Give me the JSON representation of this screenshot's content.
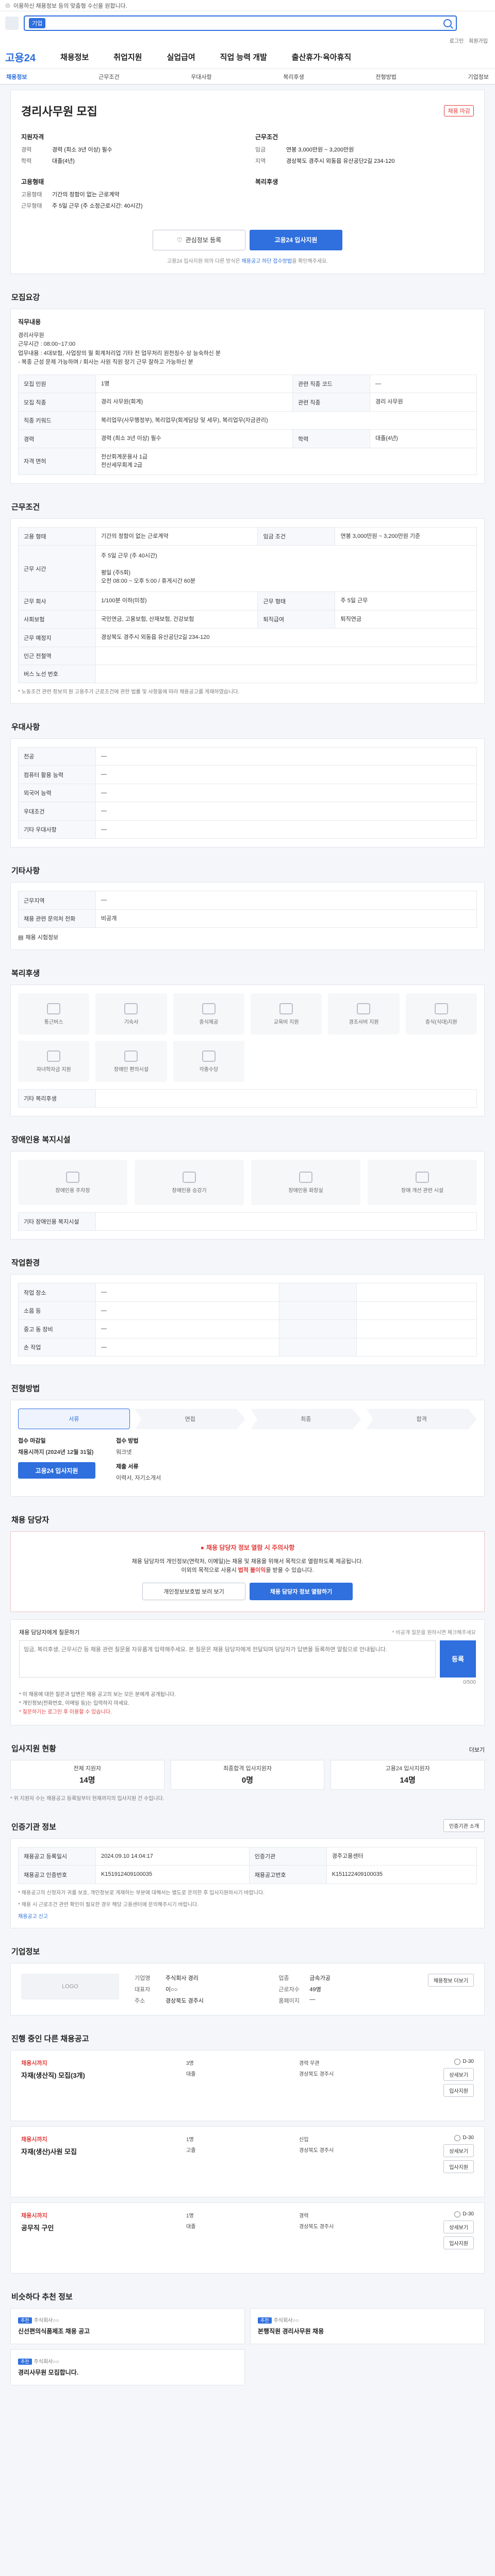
{
  "notice": {
    "text": "이용하신 채용정보 등의 맞춤형 수신을 원합니다."
  },
  "search": {
    "tag": "기업",
    "placeholder": ""
  },
  "util": {
    "login": "로그인",
    "join": "회원가입"
  },
  "gnb": {
    "brand": "고용24",
    "menus": [
      "채용정보",
      "취업지원",
      "실업급여",
      "직업 능력 개발",
      "출산휴가·육아휴직"
    ]
  },
  "tabs": [
    "채용정보",
    "근무조건",
    "우대사항",
    "복리후생",
    "전형방법",
    "기업정보"
  ],
  "summary": {
    "company": "",
    "title": "경리사무원 모집",
    "badge": "채용 마감",
    "left_title": "지원자격",
    "left": [
      {
        "k": "경력",
        "v": "경력 (최소 3년 이상) 필수"
      },
      {
        "k": "학력",
        "v": "대졸(4년)"
      }
    ],
    "right_title": "근무조건",
    "right": [
      {
        "k": "임금",
        "v": "연봉 3,000만원 ~ 3,200만원"
      },
      {
        "k": "지역",
        "v": "경상북도 경주시 외동읍 유산공단2길 234-120"
      }
    ],
    "left_title2": "고용형태",
    "left2": [
      {
        "k": "고용형태",
        "v": "기간의 정함이 없는 근로계약"
      },
      {
        "k": "근무형태",
        "v": "주 5일 근무 (주 소정근로시간: 40시간)"
      }
    ],
    "right_title2": "복리후생",
    "interest_btn": "관심정보 등록",
    "apply_btn": "고용24 입사지원",
    "note_prefix": "고용24 입사지원 외의 다른 방식은 ",
    "note_link": "채용공고 하단 접수방법",
    "note_suffix": "을 확인해주세요."
  },
  "recruit": {
    "title": "모집요강",
    "job_title": "직무내용",
    "job_text": "경리사무원\n근무시간 : 08:00~17:00\n업무내용 : 4대보험, 사업장의 월 회계처리업 기타 전 업무처리 원천징수 상 능숙하신 분\n  - 복종 근성 문제 가능하며 / 회사는 사원 직원 장기 근무 잘하고 가능하신 분",
    "rows": [
      {
        "k1": "모집 인원",
        "v1": "1명",
        "k2": "관련 직종 코드",
        "v2": "—"
      },
      {
        "k1": "모집 직종",
        "v1": "경리 사무원(회계)",
        "k2": "관련 직종",
        "v2": "경리 사무원"
      },
      {
        "k1": "직종 키워드",
        "v1": "복리업무(사무행정부), 복리업무(회계담당 및 세무), 복리업무(자금관리)",
        "k2": "",
        "v2": ""
      },
      {
        "k1": "경력",
        "v1": "경력 (최소 3년 이상) 필수",
        "k2": "학력",
        "v2": "대졸(4년)"
      },
      {
        "k1": "자격 면허",
        "v1": "전산회계운용사 1급\n전산세무회계 2급",
        "k2": "",
        "v2": ""
      }
    ]
  },
  "conditions": {
    "title": "근무조건",
    "rows": [
      {
        "k1": "고용 형태",
        "v1": "기간의 정함이 없는 근로계약",
        "k2": "임금 조건",
        "v2": "연봉 3,000만원 ~ 3,200만원 기준"
      },
      {
        "k1": "근무 시간",
        "v1": "주 5일 근무 (주 40시간)\n\n평일 (주5회)\n오전 08:00 ~ 오후 5:00 / 휴게시간 60분",
        "k2": "",
        "v2": ""
      },
      {
        "k1": "근무 회사",
        "v1": "1/100분 이하(미정)",
        "k2": "근무 형태",
        "v2": "주 5일 근무"
      },
      {
        "k1": "사회보험",
        "v1": "국민연금, 고용보험, 산재보험, 건강보험",
        "k2": "퇴직급여",
        "v2": "퇴직연금"
      },
      {
        "k1": "근무 예정지",
        "v1": "경상북도 경주시 외동읍 유산공단2길 234-120",
        "k2": "",
        "v2": ""
      },
      {
        "k1": "인근 전철역",
        "v1": "",
        "k2": "",
        "v2": ""
      },
      {
        "k1": "버스 노선 번호",
        "v1": "",
        "k2": "",
        "v2": ""
      }
    ],
    "note": "* 노동조건 관련 정보의 원 고용주가 근로조건에 관한 법률 및 사항을에 따라 채용공고를 게재하였습니다."
  },
  "preference": {
    "title": "우대사항",
    "rows": [
      {
        "k": "전공",
        "v": "—"
      },
      {
        "k": "컴퓨터 활용 능력",
        "v": "—"
      },
      {
        "k": "외국어 능력",
        "v": "—"
      },
      {
        "k": "우대조건",
        "v": "—"
      },
      {
        "k": "기타 우대사항",
        "v": "—"
      }
    ]
  },
  "other": {
    "title": "기타사항",
    "rows": [
      {
        "k": "근무지역",
        "v": "—"
      },
      {
        "k": "채용 관련 문의처 전화",
        "v": "비공개"
      }
    ],
    "more": "채용 시험정보"
  },
  "welfare": {
    "title": "복리후생",
    "items": [
      "통근버스",
      "기숙사",
      "중식제공",
      "교육비 지원",
      "경조사비 지원",
      "중식(식대)지원",
      "자녀학자금 지원",
      "장애인 편의시설",
      "각종수당"
    ],
    "footer_label": "기타 복리후생"
  },
  "disability": {
    "title": "장애인용 복지시설",
    "items": [
      "장애인용 주차장",
      "장애인용 승강기",
      "장애인용 화장실",
      "장애 개선 관련 시설"
    ],
    "footer_label": "기타 장애인용 복지시설"
  },
  "workenv": {
    "title": "작업환경",
    "rows": [
      {
        "k1": "작업 장소",
        "v1": "—",
        "k2": "",
        "v2": ""
      },
      {
        "k1": "소음 등",
        "v1": "—",
        "k2": "",
        "v2": ""
      },
      {
        "k1": "중고 동 장비",
        "v1": "—",
        "k2": "",
        "v2": ""
      },
      {
        "k1": "손 작업",
        "v1": "—",
        "k2": "",
        "v2": ""
      }
    ]
  },
  "selection": {
    "title": "전형방법",
    "steps": [
      "서류",
      "면접",
      "최종",
      "합격"
    ],
    "left": [
      {
        "h": "접수 마감일",
        "v": "채용시까지 (2024년 12월 31일)",
        "red": true
      },
      {
        "h": "",
        "v": "고용24 입사지원",
        "button": true
      }
    ],
    "right": [
      {
        "h": "접수 방법",
        "v": "워크넷"
      },
      {
        "h": "제출 서류",
        "v": "이력서, 자기소개서"
      }
    ]
  },
  "caution": {
    "title": "채용 담당자",
    "warn_title": "채용 담당자 정보 열람 시 주의사항",
    "line1": "채용 담당자의 개인정보(연락처, 이메일)는 채용 및 채용을 위해서 목적으로 열람하도록 제공됩니다.",
    "line2_pre": "이외의 목적으로 사용시 ",
    "line2_red": "법적 불이익",
    "line2_suf": "을 받을 수 있습니다.",
    "btn_outline": "개인정보보호법 보러 보기",
    "btn_primary": "채용 담당자 정보 열람하기"
  },
  "qa": {
    "title": "채용 담당자에게 질문하기",
    "count": "0/500",
    "hint": "* 비공개 질문을 원하시면 체크해주세요",
    "placeholder": "임금, 복리후생, 근무시간 등 채용 관련 질문을 자유롭게 입력해주세요. 본 질문은 채용 담당자에게 전달되며 담당자가 답변을 등록하면 알림으로 안내됩니다.",
    "submit": "등록",
    "notes": [
      "* 이 채용에 대한 질문과 답변은 채용 공고의 보는 모든 분에게 공개됩니다.",
      "* 개인정보(전화번호, 이메일 등)는 입력하지 마세요."
    ],
    "notes_red": "* 질문하기는 로그인 후 이용할 수 있습니다."
  },
  "status": {
    "title": "입사지원 현황",
    "more": "더보기",
    "stats": [
      {
        "label": "전체 지원자",
        "value": "14명"
      },
      {
        "label": "최종합격 입사지원자",
        "value": "0명"
      },
      {
        "label": "고용24 입사지원자",
        "value": "14명"
      }
    ],
    "note": "* 위 지원자 수는 채용공고 등록일부터 현재까지의 입사지원 건 수입니다."
  },
  "authority": {
    "title": "인증기관 정보",
    "btn": "인증기관 소개",
    "rows": [
      {
        "k1": "채용공고 등록일시",
        "v1": "2024.09.10 14:04:17",
        "k2": "인증기관",
        "v2": "경주고용센터"
      },
      {
        "k1": "채용공고 인증번호",
        "v1": "K151912409100035",
        "k2": "채용공고번호",
        "v2": "K151122409100035"
      }
    ],
    "note": "* 채용공고의 신청자가 귀를 보호, 개인정보로 게재하는 부분에 대해서는 별도로 문의한 후 입사지원하시기 바랍니다.",
    "note2": "* 채용 시 근로조건 관련 확인이 필요한 경우 해당 고용센터에 문의해주시기 바랍니다.",
    "report": "채용공고 신고"
  },
  "company": {
    "title": "기업정보",
    "logo": "LOGO",
    "rows": [
      {
        "k": "기업명",
        "v": "주식회사 경리"
      },
      {
        "k": "업종",
        "v": "금속가공"
      },
      {
        "k": "대표자",
        "v": "이○○"
      },
      {
        "k": "근로자수",
        "v": "49명"
      },
      {
        "k": "주소",
        "v": "경상북도 경주시"
      },
      {
        "k": "홈페이지",
        "v": "—"
      }
    ],
    "btn": "채용정보 더보기"
  },
  "other_jobs": {
    "title": "진행 중인 다른 채용공고",
    "items": [
      {
        "co": "채용시까지",
        "tt": "자재(생산직) 모집(3개)",
        "a": "3명",
        "b": "경력 무관",
        "c": "대졸",
        "d": "경상북도 경주시",
        "dday": "D-30"
      },
      {
        "co": "채용시까지",
        "tt": "자재(생산)사원 모집",
        "a": "1명",
        "b": "신입",
        "c": "고졸",
        "d": "경상북도 경주시",
        "dday": "D-30"
      },
      {
        "co": "채용시까지",
        "tt": "공무직 구인",
        "a": "1명",
        "b": "경력",
        "c": "대졸",
        "d": "경상북도 경주시",
        "dday": "D-30"
      }
    ],
    "detail_btn": "상세보기",
    "apply_btn": "입사지원"
  },
  "recommend": {
    "title": "비슷하다 추천 정보",
    "items": [
      {
        "tag": "추천",
        "tt": "신선편의식품제조 채용 공고",
        "sub": "주식회사○○"
      },
      {
        "tag": "추천",
        "tt": "본행직원 경리사무원 채용",
        "sub": "주식회사○○"
      },
      {
        "tag": "추천",
        "tt": "경리사무원 모집합니다.",
        "sub": "주식회사○○"
      }
    ]
  },
  "colors": {
    "primary": "#2f6fde",
    "danger": "#e23b3b"
  }
}
